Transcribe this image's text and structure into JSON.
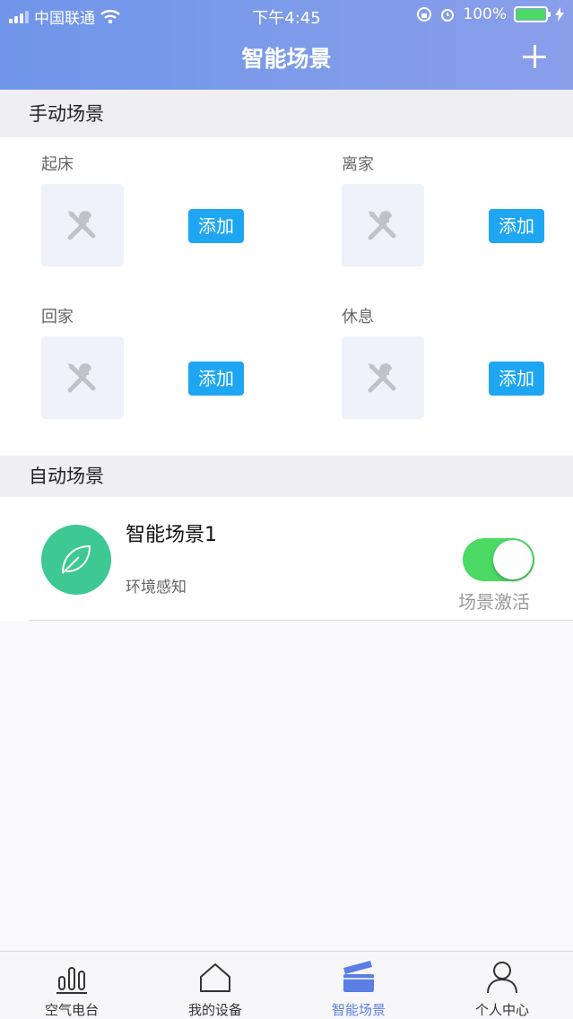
{
  "status_bar": {
    "carrier": "中国联通",
    "time": "下午4:45",
    "battery": "100%"
  },
  "nav": {
    "title": "智能场景"
  },
  "manual": {
    "section_title": "手动场景",
    "scenes": [
      {
        "name": "起床",
        "button": "添加"
      },
      {
        "name": "离家",
        "button": "添加"
      },
      {
        "name": "回家",
        "button": "添加"
      },
      {
        "name": "休息",
        "button": "添加"
      }
    ]
  },
  "auto": {
    "section_title": "自动场景",
    "items": [
      {
        "title": "智能场景1",
        "subtitle": "环境感知",
        "toggle_label": "场景激活",
        "active": true
      }
    ]
  },
  "tabbar": {
    "tabs": [
      {
        "label": "空气电台",
        "icon": "bar-chart-icon"
      },
      {
        "label": "我的设备",
        "icon": "home-icon"
      },
      {
        "label": "智能场景",
        "icon": "clapperboard-icon",
        "active": true
      },
      {
        "label": "个人中心",
        "icon": "person-icon"
      }
    ]
  },
  "colors": {
    "header": "#7a9aea",
    "accent_button": "#1ea6f2",
    "toggle_on": "#4cd964",
    "auto_icon": "#3ec893",
    "active_tab": "#5b7ee5"
  }
}
